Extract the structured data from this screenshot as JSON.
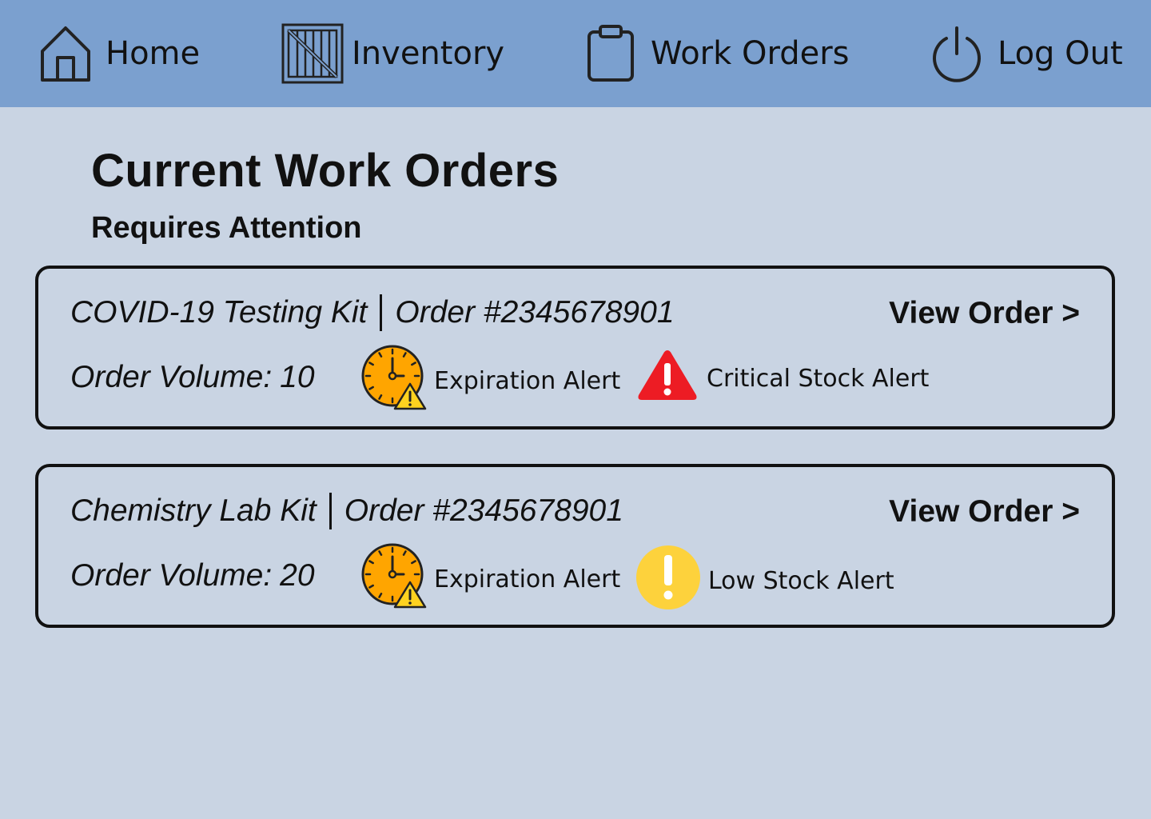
{
  "nav": {
    "items": [
      {
        "label": "Home",
        "icon": "home-icon"
      },
      {
        "label": "Inventory",
        "icon": "crate-icon"
      },
      {
        "label": "Work Orders",
        "icon": "clipboard-icon"
      },
      {
        "label": "Log Out",
        "icon": "power-icon"
      }
    ]
  },
  "page": {
    "title": "Current Work Orders",
    "section": "Requires Attention"
  },
  "orders": [
    {
      "product": "COVID-19 Testing Kit",
      "order_number": "Order #2345678901",
      "volume_label": "Order Volume:",
      "volume": "10",
      "view_label": "View Order >",
      "alerts": [
        {
          "label": "Expiration Alert",
          "icon": "expiration-clock-icon"
        },
        {
          "label": "Critical Stock Alert",
          "icon": "critical-warning-icon"
        }
      ]
    },
    {
      "product": "Chemistry Lab Kit",
      "order_number": "Order #2345678901",
      "volume_label": "Order Volume:",
      "volume": "20",
      "view_label": "View Order >",
      "alerts": [
        {
          "label": "Expiration Alert",
          "icon": "expiration-clock-icon"
        },
        {
          "label": "Low Stock Alert",
          "icon": "low-stock-exclamation-icon"
        }
      ]
    }
  ],
  "colors": {
    "navbar": "#7ba0cf",
    "background": "#c9d4e3",
    "expiration": "#ffa500",
    "critical": "#ed1c24",
    "low_stock": "#fdd23c"
  }
}
